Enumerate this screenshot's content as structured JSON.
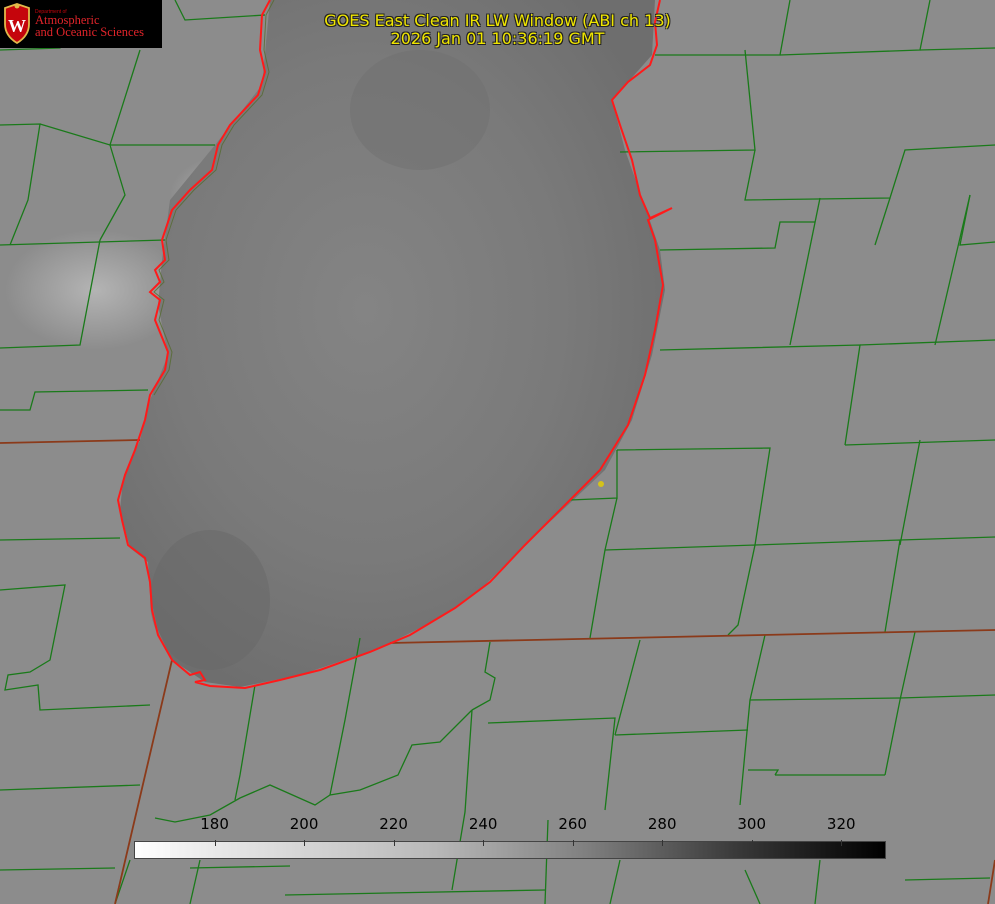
{
  "title": {
    "line1": "GOES East Clean IR LW Window (ABI ch 13)",
    "line2": "2026 Jan 01 10:36:19 GMT"
  },
  "logo": {
    "department": "Department of",
    "line1": "Atmospheric",
    "line2": "and Oceanic Sciences",
    "crest_letter": "W"
  },
  "colorbar": {
    "tick_labels": [
      "180",
      "200",
      "220",
      "240",
      "260",
      "280",
      "300",
      "320"
    ],
    "min_value": 162,
    "max_value": 330,
    "colormap": "white-to-black"
  },
  "colors": {
    "county_lines": "#1a7a1a",
    "state_lines": "#8b3a1a",
    "lake_shoreline": "#ff1a1a",
    "title_text": "#f0e600",
    "marker": "#d4c21a"
  }
}
